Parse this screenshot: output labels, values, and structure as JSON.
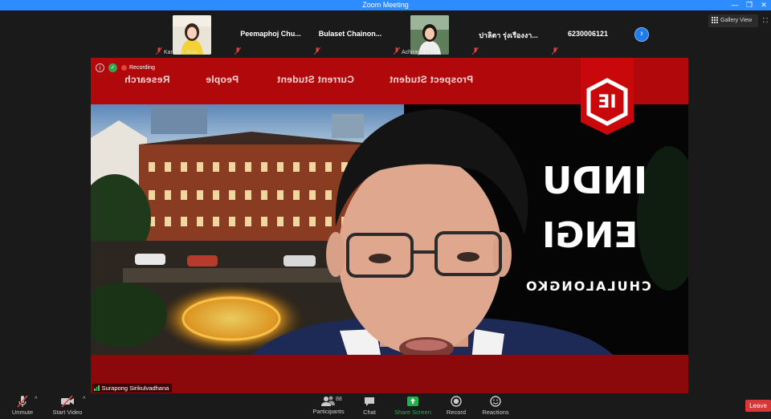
{
  "window": {
    "title": "Zoom Meeting",
    "controls": [
      "—",
      "❐",
      "✕"
    ]
  },
  "gallery": {
    "tiles": [
      {
        "name": "",
        "small_name": "Kannika Swa...",
        "has_photo": true
      },
      {
        "name": "Peemaphoj  Chu...",
        "small_name": "",
        "has_photo": false
      },
      {
        "name": "Bulaset  Chainon...",
        "small_name": "",
        "has_photo": false
      },
      {
        "name": "",
        "small_name": "Achiraya Mu...",
        "has_photo": true
      },
      {
        "name": "ปาลิตา รุ่งเรืองงา...",
        "small_name": "",
        "has_photo": false
      },
      {
        "name": "6230006121",
        "small_name": "",
        "has_photo": false
      }
    ],
    "next_icon": "chevron-right-icon",
    "view_label": "Gallery View",
    "fullscreen_icon": "fullscreen-icon"
  },
  "main_video": {
    "recording_label": "Recording",
    "nav_items": [
      "Prospect Student",
      "Current Student",
      "People",
      "Research"
    ],
    "big_text": [
      "INDU",
      "ENGI",
      "CHULALONGKO"
    ],
    "logo_text": "IE",
    "speaker_name": "Surapong Sirikulvadhana",
    "colors": {
      "banner_red": "#b1090b",
      "bottom_red": "#8b090a"
    }
  },
  "toolbar": {
    "unmute_label": "Unmute",
    "start_video_label": "Start Video",
    "participants_label": "Participants",
    "participants_count": "88",
    "chat_label": "Chat",
    "share_label": "Share Screen",
    "record_label": "Record",
    "reactions_label": "Reactions",
    "leave_label": "Leave",
    "share_color": "#22b14c",
    "leave_color": "#d73737"
  }
}
